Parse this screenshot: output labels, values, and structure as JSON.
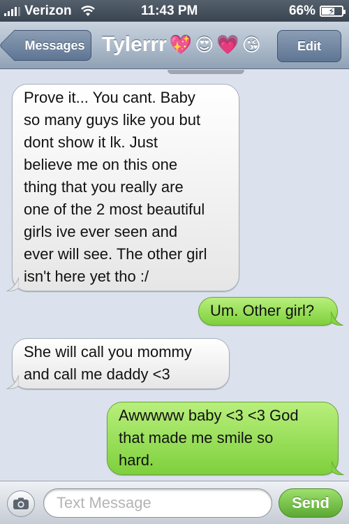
{
  "status_bar": {
    "carrier": "Verizon",
    "time": "11:43 PM",
    "battery_text": "66%",
    "battery_level": 0.66,
    "signal_icon": "signal-bars-icon",
    "wifi_icon": "wifi-icon",
    "battery_icon": "battery-charging-icon"
  },
  "nav": {
    "back_label": "Messages",
    "contact_name": "Tylerrr",
    "contact_emojis": [
      "💖",
      "😍",
      "💗",
      "😘"
    ],
    "edit_label": "Edit"
  },
  "messages": [
    {
      "direction": "received",
      "lines": [
        "Prove it... You cant. Baby",
        "so many guys like you but",
        "dont show it lk. Just",
        "believe me on this  one",
        "thing that you really are",
        "one of the 2 most beautiful",
        "girls ive ever seen and",
        "ever will see. The other girl",
        "isn't here yet tho :/"
      ]
    },
    {
      "direction": "sent",
      "lines": [
        "Um. Other girl?"
      ]
    },
    {
      "direction": "received",
      "lines": [
        "She will call you mommy",
        "and call me daddy <3"
      ]
    },
    {
      "direction": "sent",
      "lines": [
        "Awwwww baby <3 <3 God",
        "that made me smile so",
        "hard."
      ]
    }
  ],
  "input_bar": {
    "placeholder": "Text Message",
    "send_label": "Send",
    "camera_icon": "camera-icon"
  },
  "colors": {
    "received_bubble": "#ffffff",
    "sent_bubble": "#9ee06d",
    "chat_background": "#dbe2ed",
    "nav_bar": "#aebccb"
  }
}
